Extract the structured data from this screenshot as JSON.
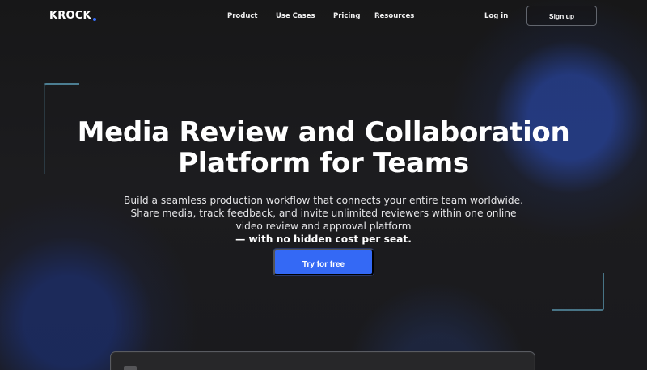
{
  "brand": {
    "name": "KROCK",
    "accent_color": "#3770ff"
  },
  "nav": {
    "links": [
      "Product",
      "Use Cases",
      "Pricing",
      "Resources"
    ],
    "login": "Log in",
    "signup": "Sign up"
  },
  "hero": {
    "title_lines": [
      "Media Review and Collaboration",
      "Platform for Teams"
    ],
    "subtitle_lines": [
      "Build a seamless production workflow that connects your entire team worldwide.",
      "Share media, track feedback, and invite unlimited reviewers within one online",
      "video review and approval platform"
    ],
    "subtitle_emphasis": "— with no hidden cost per seat.",
    "cta": "Try for free"
  },
  "colors": {
    "background": "#1b1b1e",
    "cta": "#3469f5",
    "decor_line": "#6ebedc"
  }
}
